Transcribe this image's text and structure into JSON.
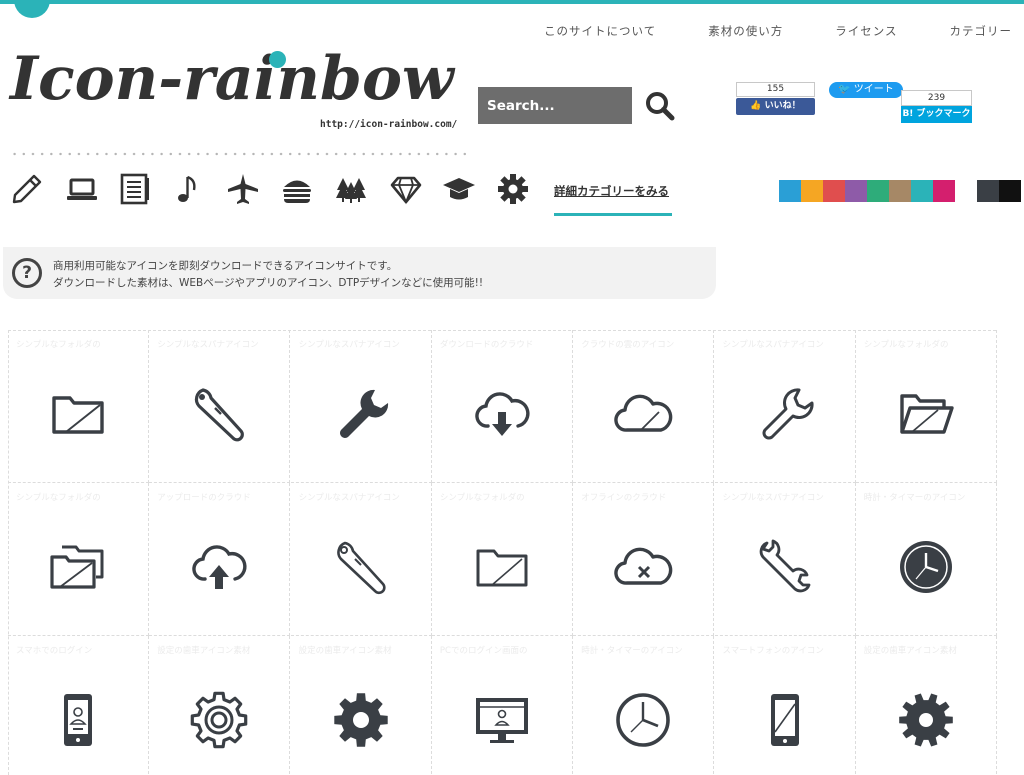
{
  "nav": {
    "items": [
      "このサイトについて",
      "素材の使い方",
      "ライセンス",
      "カテゴリー"
    ]
  },
  "logo": {
    "text": "Icon-rainbow",
    "url": "http://icon-rainbow.com/"
  },
  "search": {
    "placeholder": "Search..."
  },
  "social": {
    "fb_count": "155",
    "fb_label": "👍 いいね！",
    "tweet_label": "🐦 ツイート",
    "hatena_count": "239",
    "hatena_label": "B! ブックマーク"
  },
  "categories": {
    "icons": [
      "pencil-icon",
      "laptop-icon",
      "notebook-icon",
      "music-note-icon",
      "airplane-icon",
      "burger-icon",
      "trees-icon",
      "diamond-icon",
      "graduation-cap-icon",
      "gear-icon"
    ],
    "detail_link": "詳細カテゴリーをみる"
  },
  "colors": {
    "accent": "#2bb3b8",
    "icon": "#3a3f45",
    "swatches": [
      "#2a9fd6",
      "#f5a623",
      "#e04e4e",
      "#8e5ba8",
      "#2eac7a",
      "#a68866",
      "#2bb3b8",
      "#d41f6e"
    ],
    "swatches_dark": [
      "#3a3f45",
      "#111111"
    ]
  },
  "info": {
    "line1": "商用利用可能なアイコンを即刻ダウンロードできるアイコンサイトです。",
    "line2": "ダウンロードした素材は、WEBページやアプリのアイコン、DTPデザインなどに使用可能!!"
  },
  "grid": {
    "cells": [
      {
        "title": "シンプルなフォルダの",
        "icon": "folder-icon"
      },
      {
        "title": "シンプルなスパナアイコン",
        "icon": "adjustable-wrench-icon"
      },
      {
        "title": "シンプルなスパナアイコン",
        "icon": "wrench-icon"
      },
      {
        "title": "ダウンロードのクラウド",
        "icon": "cloud-download-icon"
      },
      {
        "title": "クラウドの雲のアイコン",
        "icon": "cloud-icon"
      },
      {
        "title": "シンプルなスパナアイコン",
        "icon": "wrench-outline-icon"
      },
      {
        "title": "シンプルなフォルダの",
        "icon": "folder-open-icon"
      },
      {
        "title": "シンプルなフォルダの",
        "icon": "folders-icon"
      },
      {
        "title": "アップロードのクラウド",
        "icon": "cloud-upload-icon"
      },
      {
        "title": "シンプルなスパナアイコン",
        "icon": "adjustable-wrench-outline-icon"
      },
      {
        "title": "シンプルなフォルダの",
        "icon": "folder-outline-icon"
      },
      {
        "title": "オフラインのクラウド",
        "icon": "cloud-offline-icon"
      },
      {
        "title": "シンプルなスパナアイコン",
        "icon": "double-wrench-icon"
      },
      {
        "title": "時計・タイマーのアイコン",
        "icon": "wall-clock-icon"
      },
      {
        "title": "スマホでのログイン",
        "icon": "smartphone-profile-icon"
      },
      {
        "title": "設定の歯車アイコン素材",
        "icon": "gear-outline-icon"
      },
      {
        "title": "設定の歯車アイコン素材",
        "icon": "gear-bold-icon"
      },
      {
        "title": "PCでのログイン画面の",
        "icon": "monitor-profile-icon"
      },
      {
        "title": "時計・タイマーのアイコン",
        "icon": "clock-icon"
      },
      {
        "title": "スマートフォンのアイコン",
        "icon": "smartphone-icon"
      },
      {
        "title": "設定の歯車アイコン素材",
        "icon": "gear-solid-icon"
      }
    ]
  }
}
